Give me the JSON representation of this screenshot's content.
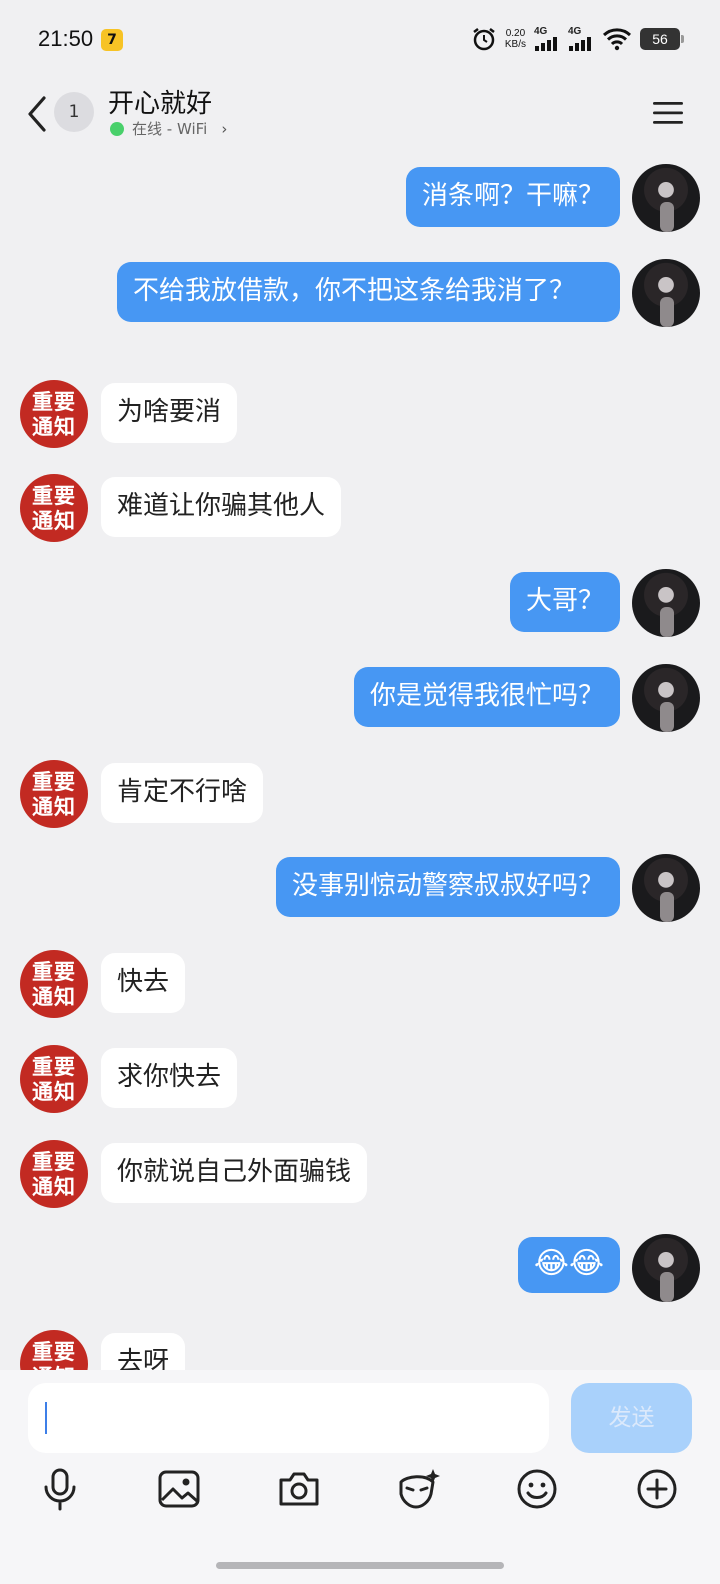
{
  "status_bar": {
    "time": "21:50",
    "app_badge": "7",
    "net_speed_value": "0.20",
    "net_speed_unit": "KB/s",
    "signal1_label": "4G",
    "signal2_label": "4G",
    "battery": "56"
  },
  "header": {
    "unread_count": "1",
    "title": "开心就好",
    "presence": "在线 - WiFi",
    "presence_color": "#49d06b"
  },
  "messages": [
    {
      "side": "self",
      "text": "消条啊？干嘛？"
    },
    {
      "side": "self",
      "text": "不给我放借款，你不把这条给我消了？"
    },
    {
      "side": "other",
      "text": "为啥要消"
    },
    {
      "side": "other",
      "text": "难道让你骗其他人"
    },
    {
      "side": "self",
      "text": "大哥？"
    },
    {
      "side": "self",
      "text": "你是觉得我很忙吗？"
    },
    {
      "side": "other",
      "text": "肯定不行啥"
    },
    {
      "side": "self",
      "text": "没事别惊动警察叔叔好吗？"
    },
    {
      "side": "other",
      "text": "快去"
    },
    {
      "side": "other",
      "text": "求你快去"
    },
    {
      "side": "other",
      "text": "你就说自己外面骗钱"
    },
    {
      "side": "self",
      "text": "😂😂"
    },
    {
      "side": "other",
      "text": "去呀"
    }
  ],
  "other_avatar": {
    "line1": "重要",
    "line2": "通知",
    "color": "#c22a22"
  },
  "input": {
    "value": "",
    "placeholder": ""
  },
  "send_label": "发送",
  "toolbar_icons": [
    "microphone-icon",
    "image-icon",
    "camera-icon",
    "sticker-icon",
    "emoji-icon",
    "plus-icon"
  ],
  "colors": {
    "self_bubble": "#4797f3",
    "other_bubble": "#ffffff",
    "background": "#f0f0f2"
  }
}
